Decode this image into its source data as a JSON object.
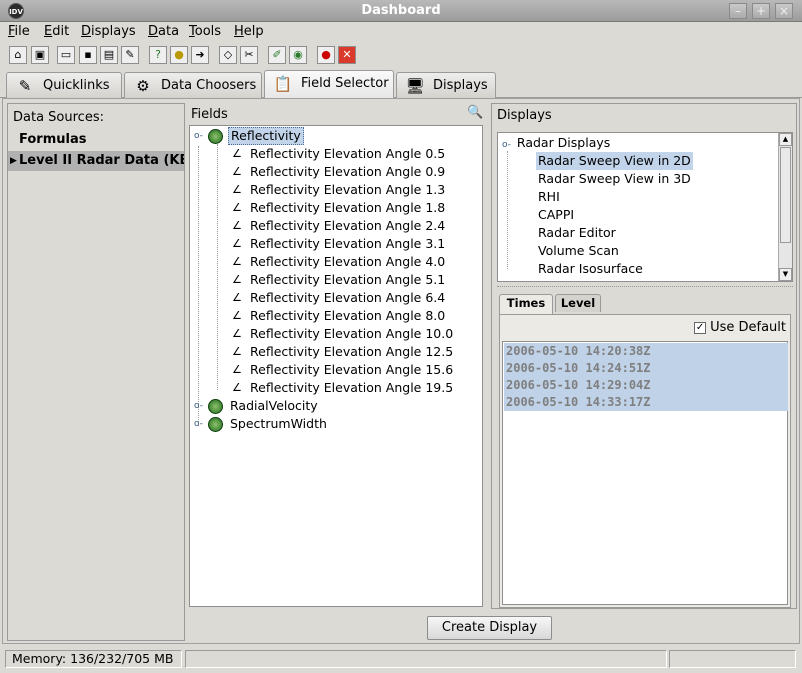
{
  "window": {
    "title": "Dashboard",
    "icon_text": "IDV",
    "controls": [
      "–",
      "+",
      "×"
    ]
  },
  "menus": [
    "File",
    "Edit",
    "Displays",
    "Data",
    "Tools",
    "Help"
  ],
  "toolbar_icons": [
    "home-icon",
    "new-window-icon",
    "open-folder-icon",
    "save-icon",
    "save-as-icon",
    "properties-icon",
    "help-icon",
    "tip-icon",
    "forward-icon",
    "erase-icon",
    "cut-icon",
    "edit-icon",
    "globe-icon",
    "stop-icon",
    "close-icon"
  ],
  "tabs": [
    {
      "label": "Quicklinks",
      "icon": "quicklinks-icon",
      "glyph": "✎"
    },
    {
      "label": "Data Choosers",
      "icon": "binoculars-icon",
      "glyph": "⚙"
    },
    {
      "label": "Field Selector",
      "icon": "clipboard-icon",
      "glyph": "📋"
    },
    {
      "label": "Displays",
      "icon": "monitor-icon",
      "glyph": "🖥"
    }
  ],
  "sources": {
    "header": "Data Sources:",
    "items": [
      "Formulas",
      "Level II Radar Data (KBM"
    ]
  },
  "fields": {
    "header": "Fields",
    "groups": [
      {
        "label": "Reflectivity",
        "expanded": true,
        "children": [
          "Reflectivity Elevation Angle 0.5",
          "Reflectivity Elevation Angle 0.9",
          "Reflectivity Elevation Angle 1.3",
          "Reflectivity Elevation Angle 1.8",
          "Reflectivity Elevation Angle 2.4",
          "Reflectivity Elevation Angle 3.1",
          "Reflectivity Elevation Angle 4.0",
          "Reflectivity Elevation Angle 5.1",
          "Reflectivity Elevation Angle 6.4",
          "Reflectivity Elevation Angle 8.0",
          "Reflectivity Elevation Angle 10.0",
          "Reflectivity Elevation Angle 12.5",
          "Reflectivity Elevation Angle 15.6",
          "Reflectivity Elevation Angle 19.5"
        ]
      },
      {
        "label": "RadialVelocity",
        "expanded": false,
        "children": []
      },
      {
        "label": "SpectrumWidth",
        "expanded": false,
        "children": []
      }
    ]
  },
  "displays": {
    "header": "Displays",
    "group": "Radar Displays",
    "items": [
      "Radar Sweep View in 2D",
      "Radar Sweep View in 3D",
      "RHI",
      "CAPPI",
      "Radar Editor",
      "Volume Scan",
      "Radar Isosurface"
    ],
    "selected_index": 0
  },
  "subtabs": [
    "Times",
    "Level"
  ],
  "times": {
    "use_default_label": "Use Default",
    "use_default_checked": true,
    "list": [
      "2006-05-10 14:20:38Z",
      "2006-05-10 14:24:51Z",
      "2006-05-10 14:29:04Z",
      "2006-05-10 14:33:17Z"
    ]
  },
  "create_display_label": "Create Display",
  "status": {
    "memory": "Memory: 136/232/705 MB",
    "message": "",
    "extra": ""
  }
}
